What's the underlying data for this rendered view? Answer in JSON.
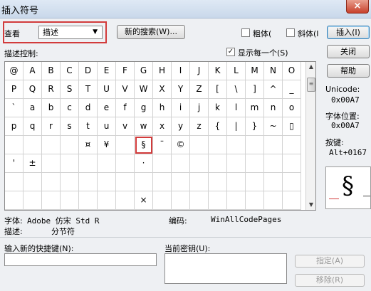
{
  "window": {
    "title": "插入符号",
    "close_glyph": "×"
  },
  "view": {
    "label": "查看",
    "value": "描述",
    "arrow": "▼"
  },
  "toolbar": {
    "new_search": "新的搜索(W)...",
    "bold": "粗体(",
    "italic": "斜体(I",
    "insert": "插入(I)",
    "close": "关闭",
    "help": "帮助"
  },
  "desc_label": "描述控制:",
  "show_each": "显示每一个(S)",
  "grid": [
    [
      "@",
      "A",
      "B",
      "C",
      "D",
      "E",
      "F",
      "G",
      "H",
      "I",
      "J",
      "K",
      "L",
      "M",
      "N",
      "O"
    ],
    [
      "P",
      "Q",
      "R",
      "S",
      "T",
      "U",
      "V",
      "W",
      "X",
      "Y",
      "Z",
      "[",
      "\\",
      "]",
      "^",
      "_"
    ],
    [
      "`",
      "a",
      "b",
      "c",
      "d",
      "e",
      "f",
      "g",
      "h",
      "i",
      "j",
      "k",
      "l",
      "m",
      "n",
      "o"
    ],
    [
      "p",
      "q",
      "r",
      "s",
      "t",
      "u",
      "v",
      "w",
      "x",
      "y",
      "z",
      "{",
      "|",
      "}",
      "~",
      "▯"
    ],
    [
      "",
      "",
      "",
      "",
      "¤",
      "¥",
      "",
      "§",
      "¨",
      "©",
      "",
      "",
      "",
      "",
      "",
      ""
    ],
    [
      "'",
      "±",
      "",
      "",
      "",
      "",
      "",
      "·",
      "",
      "",
      "",
      "",
      "",
      "",
      "",
      ""
    ],
    [
      "",
      "",
      "",
      "",
      "",
      "",
      "",
      "",
      "",
      "",
      "",
      "",
      "",
      "",
      "",
      ""
    ],
    [
      "",
      "",
      "",
      "",
      "",
      "",
      "",
      "×",
      "",
      "",
      "",
      "",
      "",
      "",
      "",
      ""
    ]
  ],
  "selected_char": "§",
  "info": {
    "unicode_label": "Unicode:",
    "unicode_value": "0x00A7",
    "charpos_label": "字体位置:",
    "charpos_value": "0x00A7",
    "key_label": "按键:",
    "key_value": "Alt+0167",
    "preview_glyph": "§"
  },
  "font_line": {
    "label": "字体:",
    "value": "Adobe 仿宋 Std R"
  },
  "encoding_line": {
    "label": "编码:",
    "value": "WinAllCodePages"
  },
  "desc_line": {
    "label": "描述:",
    "value": "分节符"
  },
  "shortcut": {
    "label": "输入新的快捷键(N):",
    "value": ""
  },
  "current": {
    "label": "当前密钥(U):",
    "value": ""
  },
  "assign_button": "指定(A)",
  "remove_button": "移除(R)",
  "checked_mark": "✓",
  "colors": {
    "highlight": "#d23b3b"
  }
}
